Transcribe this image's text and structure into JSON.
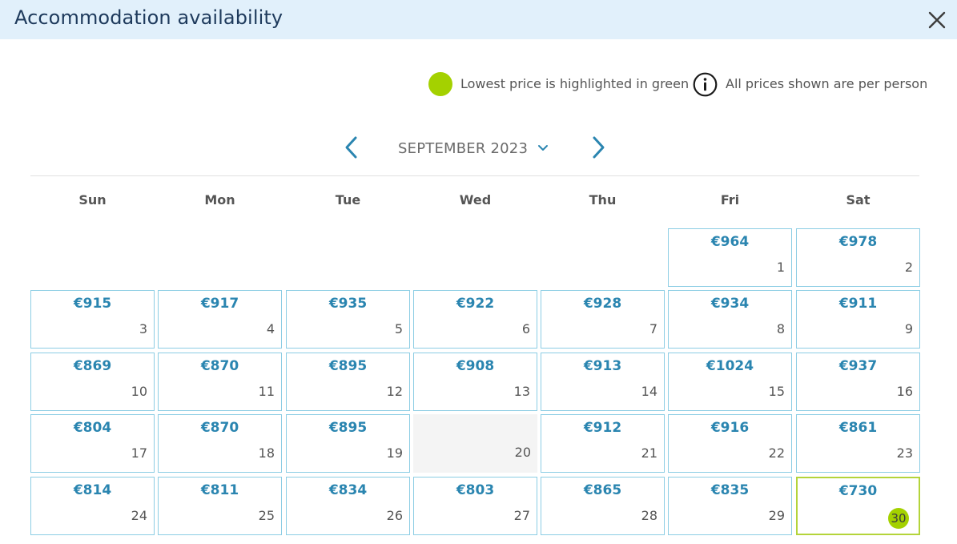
{
  "header": {
    "title": "Accommodation availability"
  },
  "legend": {
    "lowest_text": "Lowest price is highlighted in green",
    "info_text": "All prices shown are per person"
  },
  "calendar": {
    "month_label": "SEPTEMBER 2023",
    "weekdays": [
      "Sun",
      "Mon",
      "Tue",
      "Wed",
      "Thu",
      "Fri",
      "Sat"
    ],
    "days": [
      {
        "day": "1",
        "price": "€964"
      },
      {
        "day": "2",
        "price": "€978"
      },
      {
        "day": "3",
        "price": "€915"
      },
      {
        "day": "4",
        "price": "€917"
      },
      {
        "day": "5",
        "price": "€935"
      },
      {
        "day": "6",
        "price": "€922"
      },
      {
        "day": "7",
        "price": "€928"
      },
      {
        "day": "8",
        "price": "€934"
      },
      {
        "day": "9",
        "price": "€911"
      },
      {
        "day": "10",
        "price": "€869"
      },
      {
        "day": "11",
        "price": "€870"
      },
      {
        "day": "12",
        "price": "€895"
      },
      {
        "day": "13",
        "price": "€908"
      },
      {
        "day": "14",
        "price": "€913"
      },
      {
        "day": "15",
        "price": "€1024"
      },
      {
        "day": "16",
        "price": "€937"
      },
      {
        "day": "17",
        "price": "€804"
      },
      {
        "day": "18",
        "price": "€870"
      },
      {
        "day": "19",
        "price": "€895"
      },
      {
        "day": "20",
        "price": ""
      },
      {
        "day": "21",
        "price": "€912"
      },
      {
        "day": "22",
        "price": "€916"
      },
      {
        "day": "23",
        "price": "€861"
      },
      {
        "day": "24",
        "price": "€814"
      },
      {
        "day": "25",
        "price": "€811"
      },
      {
        "day": "26",
        "price": "€834"
      },
      {
        "day": "27",
        "price": "€803"
      },
      {
        "day": "28",
        "price": "€865"
      },
      {
        "day": "29",
        "price": "€835"
      },
      {
        "day": "30",
        "price": "€730"
      }
    ]
  },
  "colors": {
    "lowest_green": "#a4d100",
    "price_blue": "#2a85b0",
    "cell_border": "#8ccde4",
    "header_bg": "#e1f0fb"
  },
  "icons": {
    "close": "close-icon",
    "info": "info-icon",
    "prev": "chevron-left-icon",
    "next": "chevron-right-icon",
    "dropdown": "chevron-down-icon"
  }
}
